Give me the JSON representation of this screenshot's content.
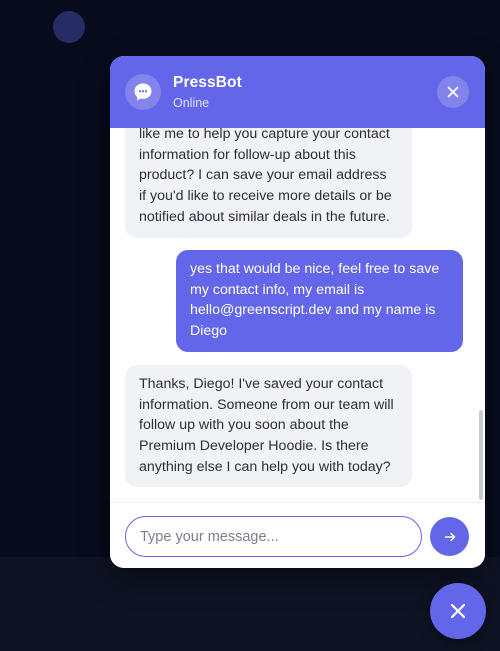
{
  "header": {
    "bot_name": "PressBot",
    "status": "Online"
  },
  "messages": [
    {
      "sender": "bot",
      "lines": [
        "like me to help you capture your contact",
        "information for follow-up about this",
        "product? I can save your email address",
        "if you'd like to receive more details or be",
        "notified about similar deals in the future."
      ]
    },
    {
      "sender": "user",
      "lines": [
        "yes that would be nice, feel free to save",
        "my contact info, my email is",
        "hello@greenscript.dev and my name is",
        "Diego"
      ]
    },
    {
      "sender": "bot",
      "lines": [
        "Thanks, Diego! I've saved your contact",
        "information. Someone from our team will",
        "follow up with you soon about the",
        "Premium Developer Hoodie. Is there",
        "anything else I can help you with today?"
      ]
    }
  ],
  "input": {
    "value": "",
    "placeholder": "Type your message..."
  },
  "icons": {
    "avatar": "chat-bubble-icon",
    "header_close": "close-icon",
    "send": "arrow-right-icon",
    "launcher": "close-icon"
  },
  "colors": {
    "accent": "#6366e8",
    "page_background": "#070b1c",
    "bot_bubble": "#f1f2f5",
    "user_bubble": "#6366e8"
  }
}
